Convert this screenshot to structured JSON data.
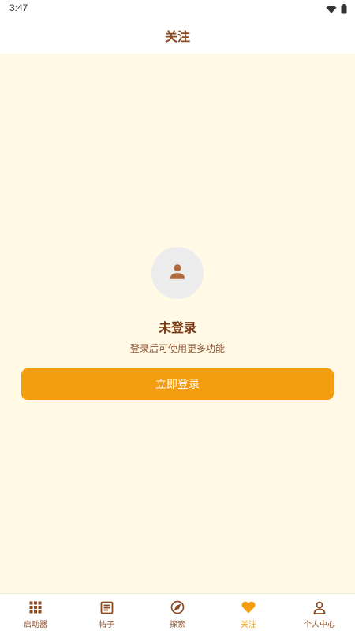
{
  "status_bar": {
    "time": "3:47",
    "wifi_icon": "wifi-icon",
    "battery_icon": "battery-icon"
  },
  "header": {
    "title": "关注"
  },
  "empty_state": {
    "avatar_icon": "person-icon",
    "title": "未登录",
    "subtitle": "登录后可使用更多功能",
    "login_button": "立即登录"
  },
  "nav": {
    "items": [
      {
        "label": "启动器",
        "icon": "grid-icon",
        "active": false
      },
      {
        "label": "帖子",
        "icon": "document-icon",
        "active": false
      },
      {
        "label": "探索",
        "icon": "compass-icon",
        "active": false
      },
      {
        "label": "关注",
        "icon": "heart-icon",
        "active": true
      },
      {
        "label": "个人中心",
        "icon": "person-icon",
        "active": false
      }
    ]
  },
  "colors": {
    "accent": "#f39c0d",
    "text_primary": "#7a3a14",
    "background": "#fff9e6"
  }
}
